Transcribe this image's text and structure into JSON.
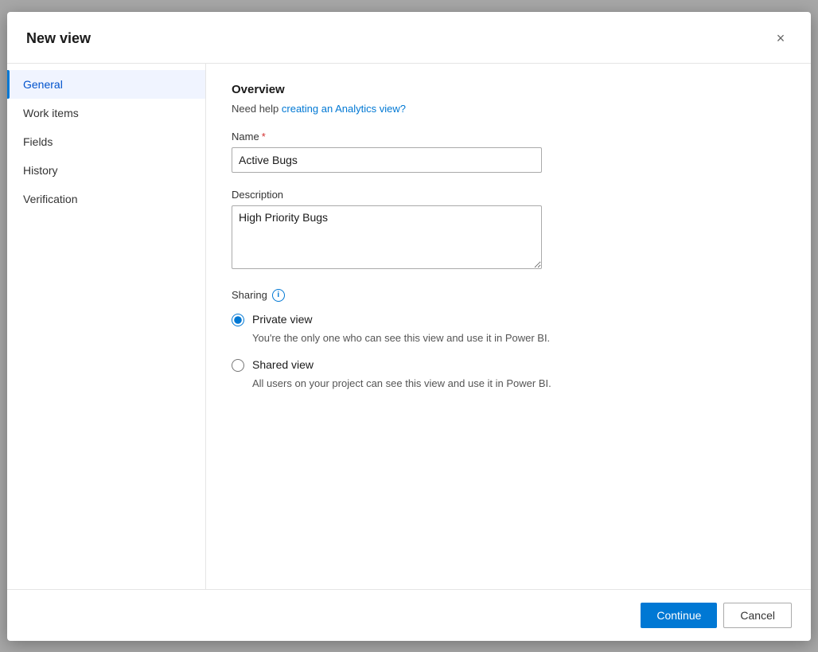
{
  "dialog": {
    "title": "New view",
    "close_label": "×"
  },
  "sidebar": {
    "items": [
      {
        "id": "general",
        "label": "General",
        "active": true
      },
      {
        "id": "work-items",
        "label": "Work items",
        "active": false
      },
      {
        "id": "fields",
        "label": "Fields",
        "active": false
      },
      {
        "id": "history",
        "label": "History",
        "active": false
      },
      {
        "id": "verification",
        "label": "Verification",
        "active": false
      }
    ]
  },
  "content": {
    "overview": {
      "section_title": "Overview",
      "help_text_prefix": "Need help ",
      "help_link_text": "creating an Analytics view?",
      "help_link_url": "#"
    },
    "form": {
      "name_label": "Name",
      "name_required": true,
      "name_value": "Active Bugs",
      "name_placeholder": "",
      "description_label": "Description",
      "description_value": "High Priority Bugs",
      "description_placeholder": ""
    },
    "sharing": {
      "label": "Sharing",
      "info_icon": "i",
      "options": [
        {
          "id": "private",
          "label": "Private view",
          "description": "You're the only one who can see this view and use it in Power BI.",
          "checked": true
        },
        {
          "id": "shared",
          "label": "Shared view",
          "description": "All users on your project can see this view and use it in Power BI.",
          "checked": false
        }
      ]
    }
  },
  "footer": {
    "continue_label": "Continue",
    "cancel_label": "Cancel"
  }
}
